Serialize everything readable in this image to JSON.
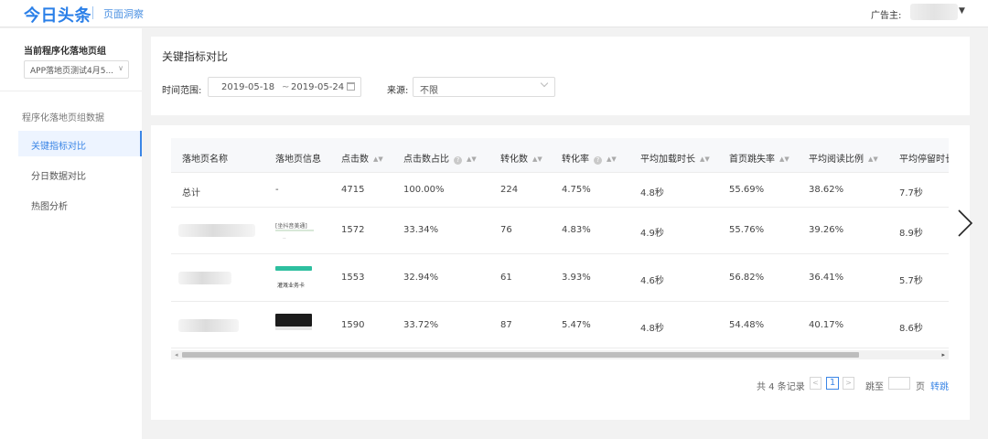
{
  "topbar": {
    "logo": "今日头条",
    "product": "页面洞察",
    "advertiser_label": "广告主:"
  },
  "sidebar": {
    "group_title": "当前程序化落地页组",
    "group_select_value": "APP落地页测试4月5...",
    "section_title": "程序化落地页组数据",
    "items": [
      {
        "label": "关键指标对比",
        "active": true
      },
      {
        "label": "分日数据对比",
        "active": false
      },
      {
        "label": "热图分析",
        "active": false
      }
    ]
  },
  "filters": {
    "title": "关键指标对比",
    "time_label": "时间范围:",
    "date_start": "2019-05-18",
    "date_sep": "~",
    "date_end": "2019-05-24",
    "source_label": "来源:",
    "source_value": "不限"
  },
  "table": {
    "headers": [
      {
        "label": "落地页名称",
        "sortable": false,
        "help": false
      },
      {
        "label": "落地页信息",
        "sortable": false,
        "help": false
      },
      {
        "label": "点击数",
        "sortable": true,
        "help": false
      },
      {
        "label": "点击数占比",
        "sortable": true,
        "help": true
      },
      {
        "label": "转化数",
        "sortable": true,
        "help": false
      },
      {
        "label": "转化率",
        "sortable": true,
        "help": true
      },
      {
        "label": "平均加载时长",
        "sortable": true,
        "help": false
      },
      {
        "label": "首页跳失率",
        "sortable": true,
        "help": false
      },
      {
        "label": "平均阅读比例",
        "sortable": true,
        "help": false
      },
      {
        "label": "平均停留时长",
        "sortable": false,
        "help": false
      }
    ],
    "total_row": {
      "name": "总计",
      "info": "-",
      "clicks": "4715",
      "click_share": "100.00%",
      "conversions": "224",
      "conversion_rate": "4.75%",
      "avg_load": "4.8秒",
      "bounce": "55.69%",
      "read_ratio": "38.62%",
      "avg_stay": "7.7秒"
    },
    "rows": [
      {
        "thumb_text": "[坐抖音美通]",
        "clicks": "1572",
        "click_share": "33.34%",
        "conversions": "76",
        "conversion_rate": "4.83%",
        "avg_load": "4.9秒",
        "bounce": "55.76%",
        "read_ratio": "39.26%",
        "avg_stay": "8.9秒"
      },
      {
        "thumb_text": "灌溉业务卡",
        "clicks": "1553",
        "click_share": "32.94%",
        "conversions": "61",
        "conversion_rate": "3.93%",
        "avg_load": "4.6秒",
        "bounce": "56.82%",
        "read_ratio": "36.41%",
        "avg_stay": "5.7秒"
      },
      {
        "thumb_text": "",
        "clicks": "1590",
        "click_share": "33.72%",
        "conversions": "87",
        "conversion_rate": "5.47%",
        "avg_load": "4.8秒",
        "bounce": "54.48%",
        "read_ratio": "40.17%",
        "avg_stay": "8.6秒"
      }
    ]
  },
  "pagination": {
    "total": "共 4 条记录",
    "prev": "<",
    "current": "1",
    "next": ">",
    "jump_label": "跳至",
    "page_unit": "页",
    "go": "转跳"
  },
  "colors": {
    "brand": "#2a7fe8",
    "active_nav": "#3b86e6",
    "thumb_green": "#2ebf9f"
  }
}
